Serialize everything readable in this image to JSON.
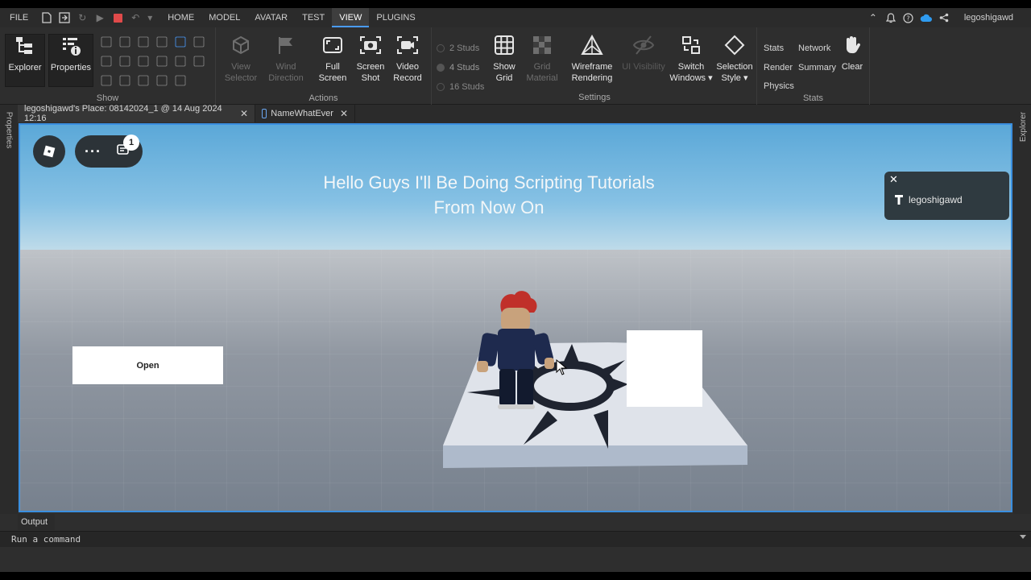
{
  "menubar": {
    "file": "FILE",
    "tabs": [
      {
        "label": "HOME"
      },
      {
        "label": "MODEL"
      },
      {
        "label": "AVATAR"
      },
      {
        "label": "TEST"
      },
      {
        "label": "VIEW"
      },
      {
        "label": "PLUGINS"
      }
    ],
    "active_tab": "VIEW",
    "username": "legoshigawd"
  },
  "ribbon": {
    "show": {
      "label": "Show",
      "explorer": "Explorer",
      "properties": "Properties"
    },
    "actions": {
      "label": "Actions",
      "view_selector": [
        "View",
        "Selector"
      ],
      "wind_direction": [
        "Wind",
        "Direction"
      ],
      "full_screen": [
        "Full",
        "Screen"
      ],
      "screen_shot": [
        "Screen",
        "Shot"
      ],
      "video_record": [
        "Video",
        "Record"
      ]
    },
    "settings": {
      "label": "Settings",
      "studs": [
        "2 Studs",
        "4 Studs",
        "16 Studs"
      ],
      "selected_studs": "4 Studs",
      "show_grid": [
        "Show",
        "Grid"
      ],
      "grid_material": [
        "Grid",
        "Material"
      ],
      "wireframe": [
        "Wireframe",
        "Rendering"
      ],
      "ui_visibility": "UI Visibility",
      "switch_windows": [
        "Switch",
        "Windows ▾"
      ],
      "selection_style": [
        "Selection",
        "Style ▾"
      ]
    },
    "stats": {
      "label": "Stats",
      "stats": "Stats",
      "network": "Network",
      "render": "Render",
      "summary": "Summary",
      "physics": "Physics",
      "clear": "Clear"
    }
  },
  "rails": {
    "left": "Properties",
    "right": "Explorer"
  },
  "doc_tabs": [
    {
      "label": "legoshigawd's Place: 08142024_1 @ 14 Aug 2024 12:16",
      "active": true
    },
    {
      "label": "NameWhatEver",
      "active": false
    }
  ],
  "viewport": {
    "greeting_line1": "Hello Guys I'll Be Doing Scripting Tutorials",
    "greeting_line2": "From Now On",
    "notification_count": "1",
    "player_name": "legoshigawd",
    "open_button": "Open"
  },
  "output": {
    "tab_label": "Output",
    "command_placeholder": "Run a command"
  },
  "colors": {
    "accent": "#3a8fe0",
    "stop": "#e04a4a",
    "background": "#2e2e2e"
  }
}
